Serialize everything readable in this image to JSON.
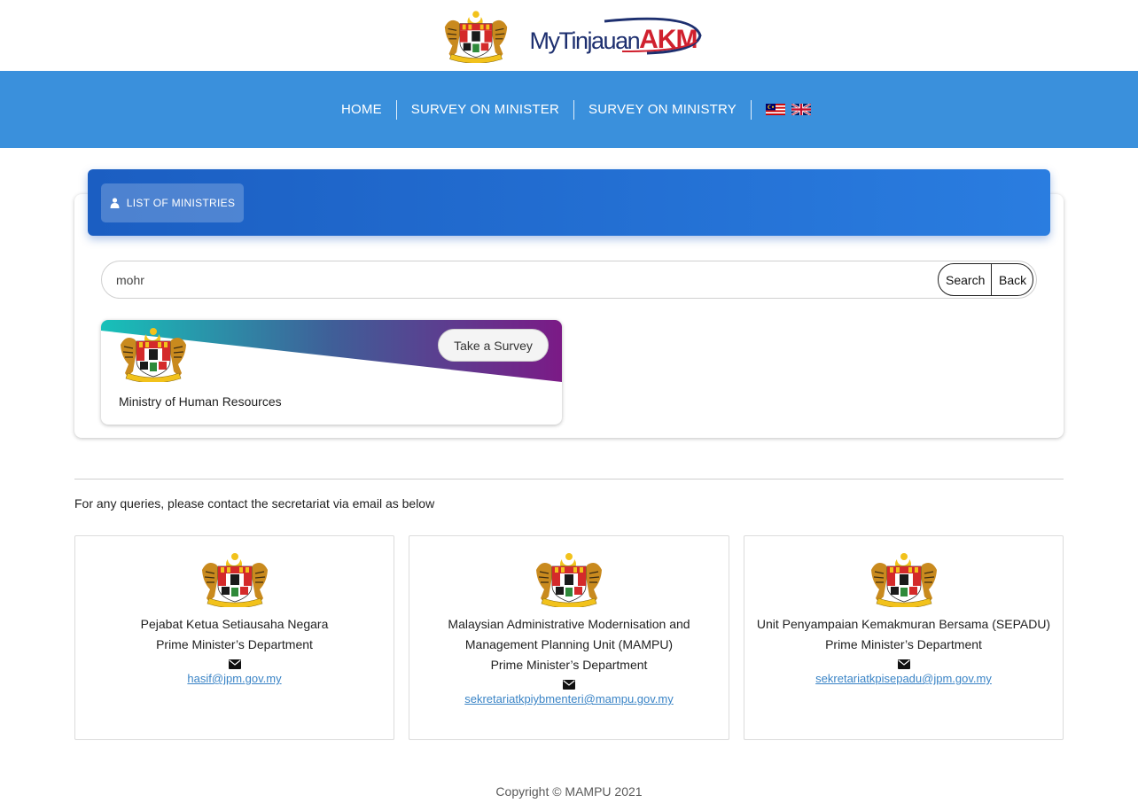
{
  "header": {
    "brand_prefix": "MyTinjauan",
    "brand_suffix": "AKM"
  },
  "nav": {
    "items": [
      {
        "label": "HOME"
      },
      {
        "label": "SURVEY ON MINISTER"
      },
      {
        "label": "SURVEY ON MINISTRY"
      }
    ],
    "languages": [
      "malaysia-flag-icon",
      "uk-flag-icon"
    ]
  },
  "main": {
    "tab_label": "LIST OF MINISTRIES",
    "search_value": "mohr",
    "search_button": "Search",
    "back_button": "Back",
    "ministries": [
      {
        "name": "Ministry of Human Resources",
        "action_label": "Take a Survey"
      }
    ]
  },
  "contact": {
    "intro": "For any queries, please contact the secretariat via email as below",
    "cards": [
      {
        "lines": [
          "Pejabat Ketua Setiausaha Negara",
          "Prime Minister’s Department"
        ],
        "email": "hasif@jpm.gov.my"
      },
      {
        "lines": [
          "Malaysian Administrative Modernisation and",
          "Management Planning Unit (MAMPU)",
          "Prime Minister’s Department"
        ],
        "email": "sekretariatkpiybmenteri@mampu.gov.my"
      },
      {
        "lines": [
          "Unit Penyampaian Kemakmuran Bersama (SEPADU)",
          "Prime Minister’s Department"
        ],
        "email": "sekretariatkpisepadu@jpm.gov.my"
      }
    ]
  },
  "footer": {
    "copyright": "Copyright © MAMPU 2021"
  },
  "colors": {
    "nav_bg": "#3a90dc",
    "header_gradient_start": "#1b5ec2",
    "header_gradient_end": "#2a7de0",
    "link": "#3a84c6",
    "banner_teal": "#17c1b9",
    "banner_purple": "#7b1a86"
  }
}
